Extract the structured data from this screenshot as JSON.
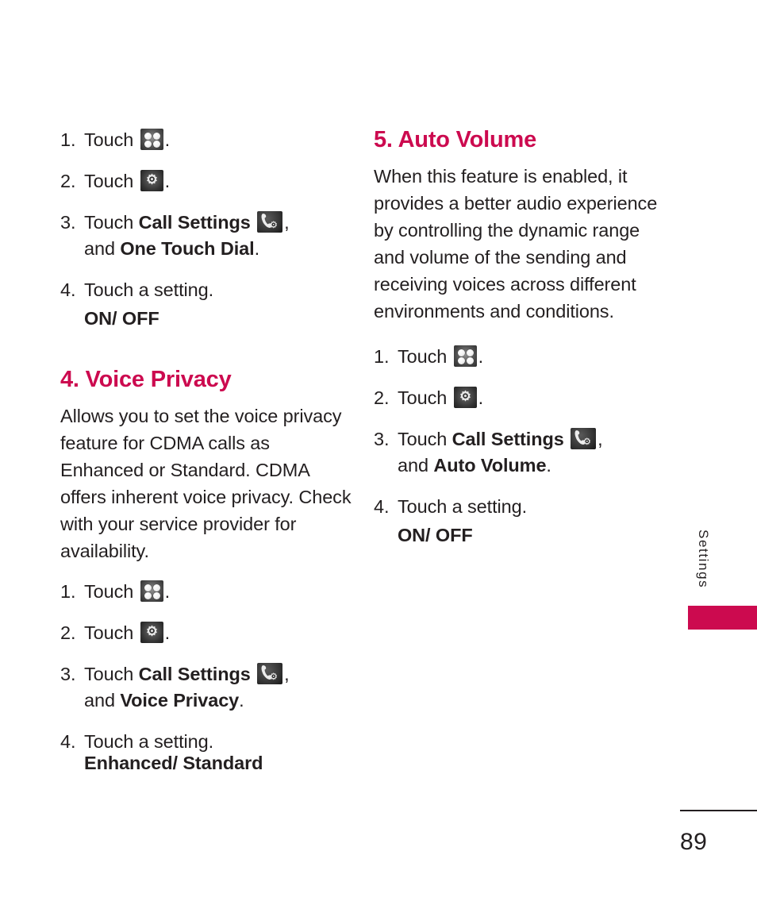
{
  "page": {
    "number": "89",
    "side_tab_label": "Settings",
    "accent_color": "#cc0a4f",
    "text_color": "#231f20"
  },
  "icons": {
    "grid": "apps-grid-icon",
    "gear": "gear-icon",
    "call_settings": "call-settings-icon"
  },
  "left_column": {
    "steps_top": [
      {
        "num": "1.",
        "text": "Touch",
        "icon": "grid",
        "after": "."
      },
      {
        "num": "2.",
        "text": "Touch",
        "icon": "gear",
        "after": "."
      },
      {
        "num": "3.",
        "text": "Touch",
        "bold1": "Call Settings",
        "icon": "call",
        "after": ",",
        "line2_pre": "and ",
        "line2_bold": "One Touch Dial",
        "line2_post": "."
      },
      {
        "num": "4.",
        "text": "Touch a setting."
      }
    ],
    "option_top": "ON/ OFF",
    "section": {
      "heading": "4. Voice Privacy",
      "body": "Allows you to set the voice privacy feature for CDMA calls as Enhanced or Standard. CDMA offers inherent voice privacy. Check with your service provider for availability."
    },
    "steps_bottom": [
      {
        "num": "1.",
        "text": "Touch",
        "icon": "grid",
        "after": "."
      },
      {
        "num": "2.",
        "text": "Touch",
        "icon": "gear",
        "after": "."
      },
      {
        "num": "3.",
        "text": "Touch",
        "bold1": "Call Settings",
        "icon": "call",
        "after": ",",
        "line2_pre": "and ",
        "line2_bold": "Voice Privacy",
        "line2_post": "."
      },
      {
        "num": "4.",
        "text": "Touch a setting."
      }
    ],
    "option_bottom": "Enhanced/ Standard"
  },
  "right_column": {
    "section": {
      "heading": "5. Auto Volume",
      "body": "When this feature is enabled, it provides a better audio experience by controlling the dynamic range and volume of the sending and receiving voices across different environments and conditions."
    },
    "steps": [
      {
        "num": "1.",
        "text": "Touch",
        "icon": "grid",
        "after": "."
      },
      {
        "num": "2.",
        "text": "Touch",
        "icon": "gear",
        "after": "."
      },
      {
        "num": "3.",
        "text": "Touch",
        "bold1": "Call Settings",
        "icon": "call",
        "after": ",",
        "line2_pre": "and ",
        "line2_bold": "Auto Volume",
        "line2_post": "."
      },
      {
        "num": "4.",
        "text": "Touch a setting."
      }
    ],
    "option": "ON/ OFF"
  }
}
